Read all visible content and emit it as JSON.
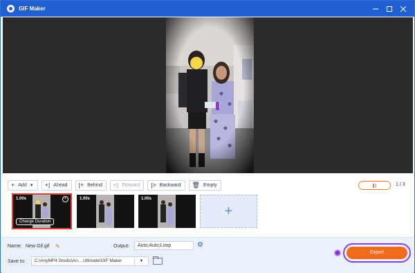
{
  "window": {
    "title": "GIF Maker",
    "controls": [
      "minimize",
      "maximize",
      "close"
    ]
  },
  "toolbar": {
    "add": "Add",
    "ahead": "Ahead",
    "behind": "Behind",
    "forward": "Forward",
    "backward": "Backward",
    "empty": "Empty"
  },
  "playback": {
    "page": "1",
    "separator": "/",
    "total": "3"
  },
  "frames": [
    {
      "duration": "1.00s",
      "selected": true,
      "change_label": "Change Duration"
    },
    {
      "duration": "1.00s",
      "selected": false
    },
    {
      "duration": "1.00s",
      "selected": false
    }
  ],
  "settings": {
    "name_label": "Name:",
    "name_value": "New Gif.gif",
    "output_label": "Output:",
    "output_value": "Auto;Auto;Loop",
    "save_label": "Save to:",
    "save_path": "C:\\AnyMP4 Studio\\An... Ultimate\\GIF Maker"
  },
  "export_label": "Export",
  "colors": {
    "title_bar": "#1f5fd1",
    "accent": "#f26b1d",
    "highlight": "#8b3fe0",
    "selected_frame": "#e23b3b"
  },
  "icons": [
    "app-icon",
    "plus-icon",
    "dropdown-icon",
    "pencil-icon",
    "gear-icon",
    "folder-icon",
    "pause-icon",
    "close-icon"
  ]
}
